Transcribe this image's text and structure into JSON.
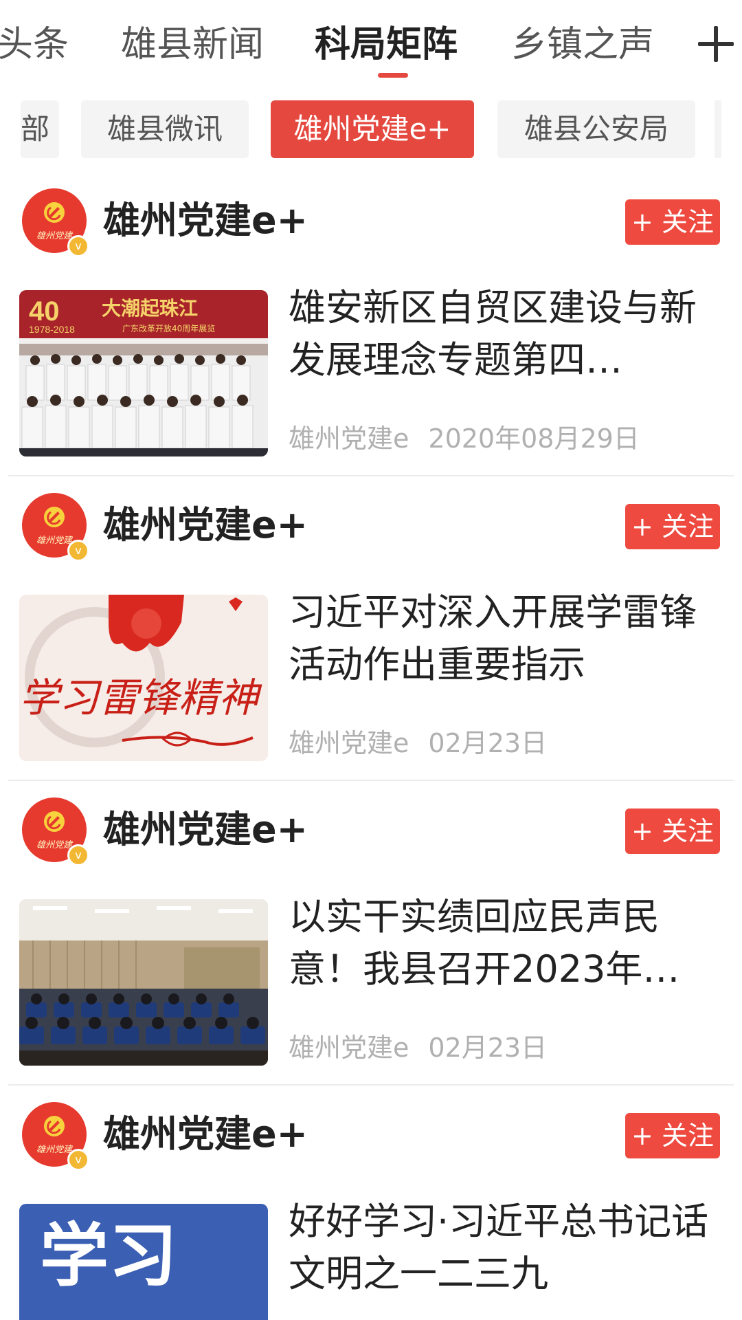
{
  "top_tabs": [
    {
      "label": "头条"
    },
    {
      "label": "雄县新闻"
    },
    {
      "label": "科局矩阵"
    },
    {
      "label": "乡镇之声"
    }
  ],
  "active_top_tab": "科局矩阵",
  "chips": [
    {
      "label": "部"
    },
    {
      "label": "雄县微讯"
    },
    {
      "label": "雄州党建e+"
    },
    {
      "label": "雄县公安局"
    }
  ],
  "active_chip": "雄州党建e+",
  "colors": {
    "accent": "#e5483f",
    "meta": "#b0b0b0"
  },
  "items": [
    {
      "account": "雄州党建e+",
      "follow_label": "+ 关注",
      "headline": "雄安新区自贸区建设与新发展理念专题第四…",
      "source": "雄州党建e",
      "date": "2020年08月29日",
      "thumb_text": {
        "year": "40",
        "title": "大潮起珠江",
        "range": "1978-2018",
        "sub": "广东改革开放40周年展览"
      }
    },
    {
      "account": "雄州党建e+",
      "follow_label": "+ 关注",
      "headline": "习近平对深入开展学雷锋活动作出重要指示",
      "source": "雄州党建e",
      "date": "02月23日",
      "thumb_text": {
        "calligraphy": "学习雷锋精神"
      }
    },
    {
      "account": "雄州党建e+",
      "follow_label": "+ 关注",
      "headline": "以实干实绩回应民声民意！我县召开2023年…",
      "source": "雄州党建e",
      "date": "02月23日"
    },
    {
      "account": "雄州党建e+",
      "follow_label": "+ 关注",
      "headline": "好好学习·习近平总书记话文明之一二三九",
      "source": "",
      "date": "",
      "thumb_text": {
        "big": "学习"
      }
    }
  ],
  "avatar_logo_text": "雄州党建"
}
